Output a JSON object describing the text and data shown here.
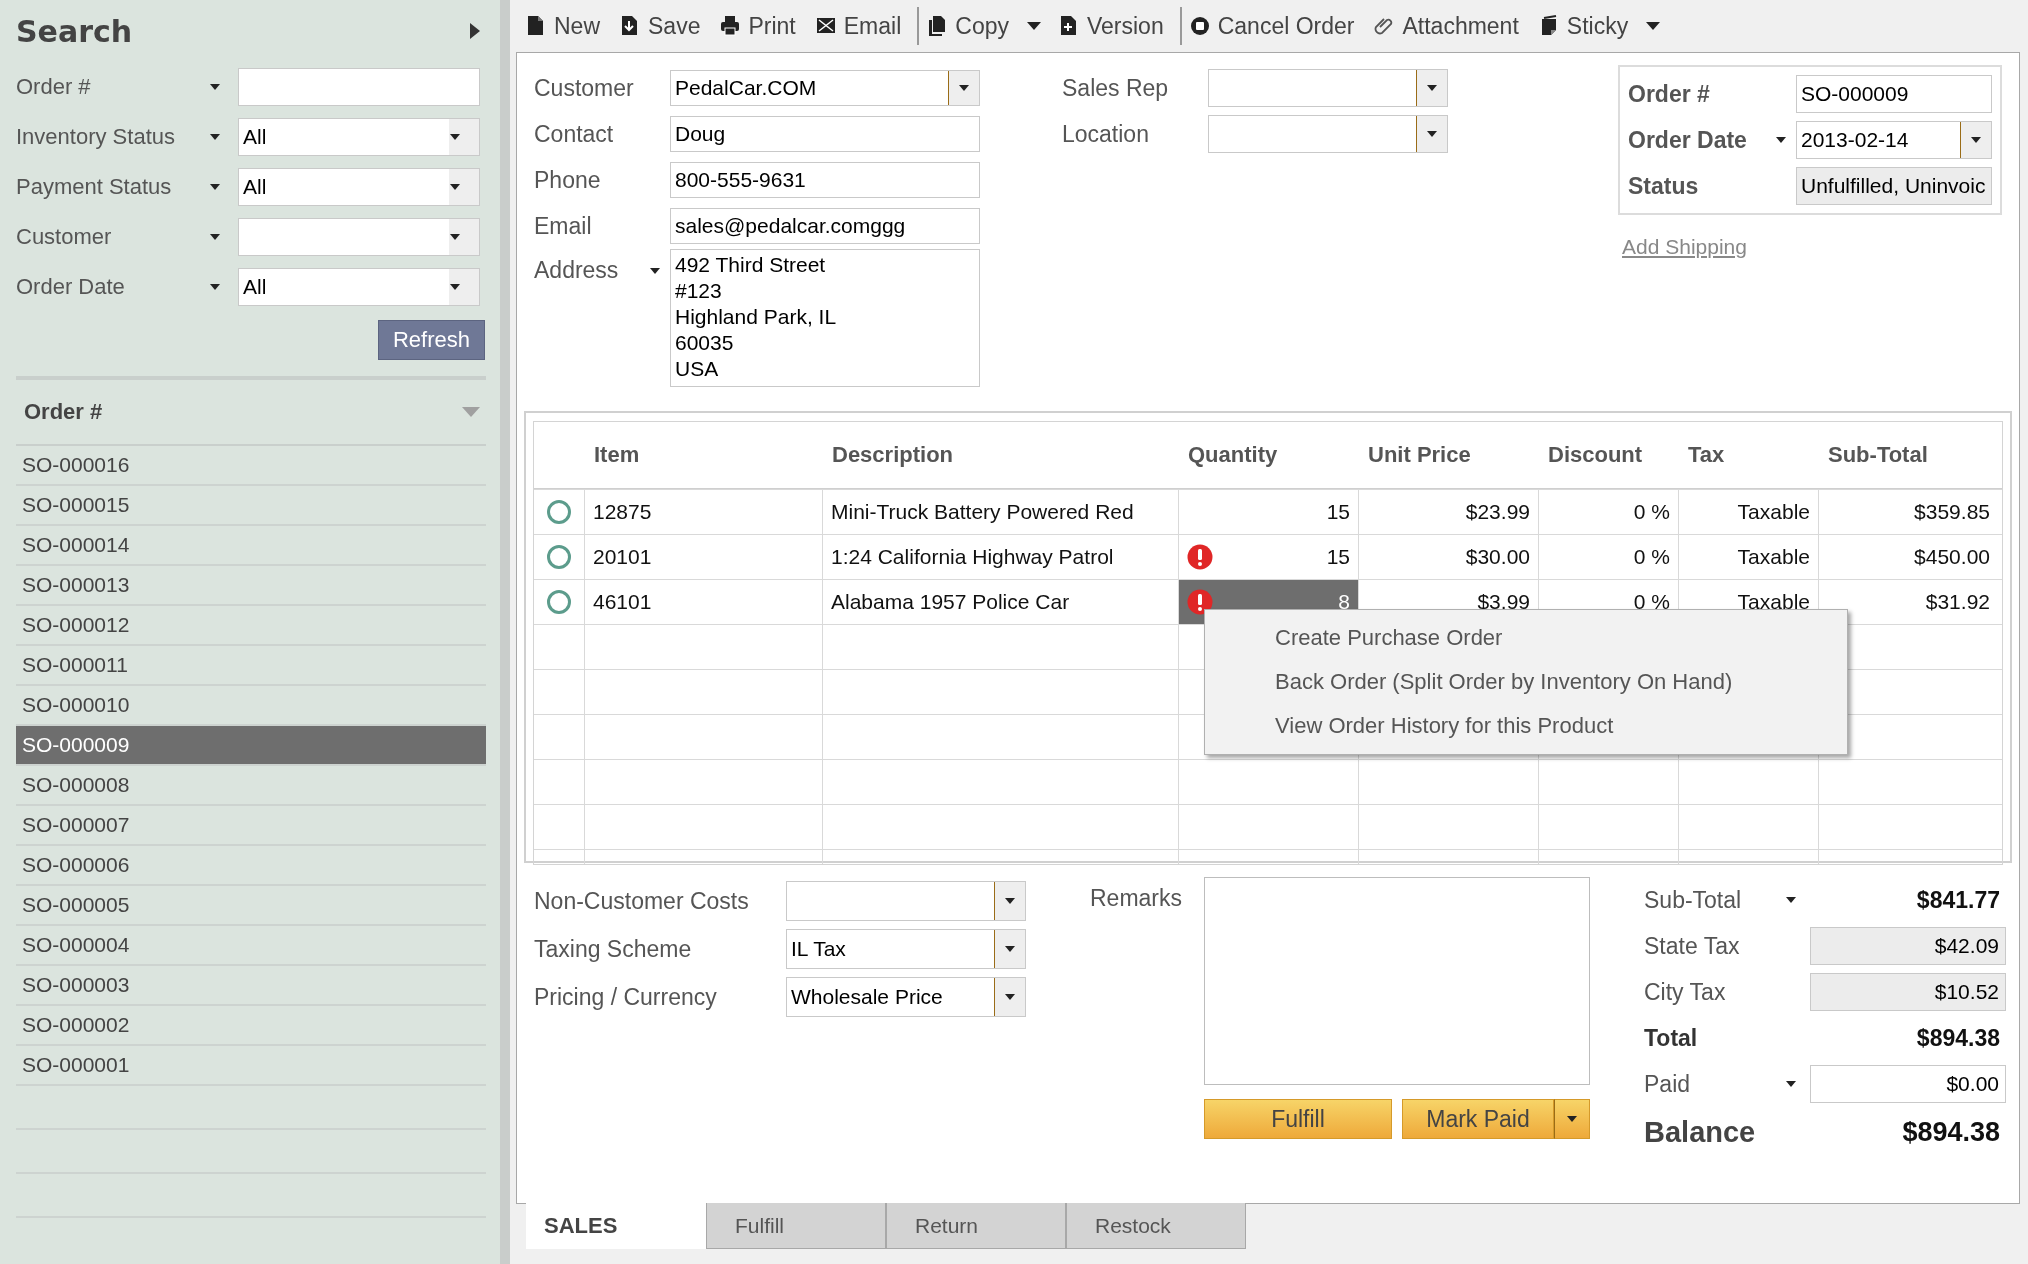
{
  "sidebar": {
    "title": "Search",
    "filters": [
      {
        "label": "Order #",
        "kind": "text"
      },
      {
        "label": "Inventory Status",
        "kind": "dropdown",
        "value": "All"
      },
      {
        "label": "Payment Status",
        "kind": "dropdown",
        "value": "All"
      },
      {
        "label": "Customer",
        "kind": "dropdown"
      },
      {
        "label": "Order Date",
        "kind": "dropdown",
        "value": "All"
      }
    ],
    "refresh_button": "Refresh",
    "list_header": "Order #",
    "orders": [
      {
        "number": "SO-000016",
        "selected": false
      },
      {
        "number": "SO-000015",
        "selected": false
      },
      {
        "number": "SO-000014",
        "selected": false
      },
      {
        "number": "SO-000013",
        "selected": false
      },
      {
        "number": "SO-000012",
        "selected": false
      },
      {
        "number": "SO-000011",
        "selected": false
      },
      {
        "number": "SO-000010",
        "selected": false
      },
      {
        "number": "SO-000009",
        "selected": true
      },
      {
        "number": "SO-000008",
        "selected": false
      },
      {
        "number": "SO-000007",
        "selected": false
      },
      {
        "number": "SO-000006",
        "selected": false
      },
      {
        "number": "SO-000005",
        "selected": false
      },
      {
        "number": "SO-000004",
        "selected": false
      },
      {
        "number": "SO-000003",
        "selected": false
      },
      {
        "number": "SO-000002",
        "selected": false
      },
      {
        "number": "SO-000001",
        "selected": false
      }
    ]
  },
  "toolbar": [
    [
      {
        "label": "New",
        "kind": "button"
      },
      {
        "label": "Save",
        "kind": "button"
      },
      {
        "label": "Print",
        "kind": "button"
      },
      {
        "label": "Email",
        "kind": "button"
      }
    ],
    [
      {
        "label": "Copy",
        "kind": "split"
      },
      {
        "label": "Version",
        "kind": "button"
      }
    ],
    [
      {
        "label": "Cancel Order",
        "kind": "button"
      },
      {
        "label": "Attachment",
        "kind": "button"
      },
      {
        "label": "Sticky",
        "kind": "split"
      }
    ]
  ],
  "customer_fields": [
    {
      "label": "Customer",
      "kind": "dropdown",
      "value": "PedalCar.COM"
    },
    {
      "label": "Contact",
      "kind": "text",
      "value": "Doug"
    },
    {
      "label": "Phone",
      "kind": "text",
      "value": "800-555-9631"
    },
    {
      "label": "Email",
      "kind": "text",
      "value": "sales@pedalcar.comggg"
    },
    {
      "label": "Address",
      "kind": "multiline",
      "menu": true,
      "lines": [
        "492 Third Street",
        "#123",
        "Highland Park, IL",
        "60035",
        "USA"
      ]
    }
  ],
  "assignment_fields": [
    {
      "label": "Sales Rep",
      "kind": "dropdown"
    },
    {
      "label": "Location",
      "kind": "dropdown"
    }
  ],
  "order_fields": [
    {
      "label": "Order #",
      "kind": "text",
      "value": "SO-000009"
    },
    {
      "label": "Order Date",
      "kind": "dropdown",
      "menu": true,
      "value": "2013-02-14"
    },
    {
      "label": "Status",
      "kind": "readonly",
      "value": "Unfulfilled, Uninvoic"
    }
  ],
  "add_shipping_link": "Add Shipping",
  "table": {
    "columns": [
      "Item",
      "Description",
      "Quantity",
      "Unit Price",
      "Discount",
      "Tax",
      "Sub-Total"
    ],
    "rows": [
      {
        "item": "12875",
        "description": "Mini-Truck Battery Powered Red",
        "quantity": "15",
        "warning": false,
        "unit_price": "$23.99",
        "discount": "0 %",
        "tax": "Taxable",
        "sub_total": "$359.85",
        "selected": false
      },
      {
        "item": "20101",
        "description": "1:24 California Highway Patrol",
        "quantity": "15",
        "warning": true,
        "unit_price": "$30.00",
        "discount": "0 %",
        "tax": "Taxable",
        "sub_total": "$450.00",
        "selected": false
      },
      {
        "item": "46101",
        "description": "Alabama 1957 Police Car",
        "quantity": "8",
        "warning": true,
        "unit_price": "$3.99",
        "discount": "0 %",
        "tax": "Taxable",
        "sub_total": "$31.92",
        "selected": true
      }
    ]
  },
  "context_menu": [
    "Create Purchase Order",
    "Back Order (Split Order by Inventory On Hand)",
    "View Order History for this Product"
  ],
  "footer_fields": [
    {
      "label": "Non-Customer Costs",
      "kind": "dropdown"
    },
    {
      "label": "Taxing Scheme",
      "kind": "dropdown",
      "value": "IL Tax"
    },
    {
      "label": "Pricing / Currency",
      "kind": "dropdown",
      "value": "Wholesale Price"
    }
  ],
  "remarks_label": "Remarks",
  "actions": [
    {
      "label": "Fulfill",
      "kind": "button"
    },
    {
      "label": "Mark Paid",
      "kind": "split"
    }
  ],
  "totals": [
    {
      "label": "Sub-Total",
      "kind": "sum",
      "menu": true,
      "value": "$841.77"
    },
    {
      "label": "State Tax",
      "kind": "readonly",
      "value": "$42.09"
    },
    {
      "label": "City Tax",
      "kind": "readonly",
      "value": "$10.52"
    },
    {
      "label": "Total",
      "kind": "total",
      "value": "$894.38"
    },
    {
      "label": "Paid",
      "kind": "input",
      "menu": true,
      "value": "$0.00"
    },
    {
      "label": "Balance",
      "kind": "balance",
      "value": "$894.38"
    }
  ],
  "tabs": [
    {
      "label": "SALES",
      "selected": true
    },
    {
      "label": "Fulfill",
      "selected": false
    },
    {
      "label": "Return",
      "selected": false
    },
    {
      "label": "Restock",
      "selected": false
    }
  ]
}
